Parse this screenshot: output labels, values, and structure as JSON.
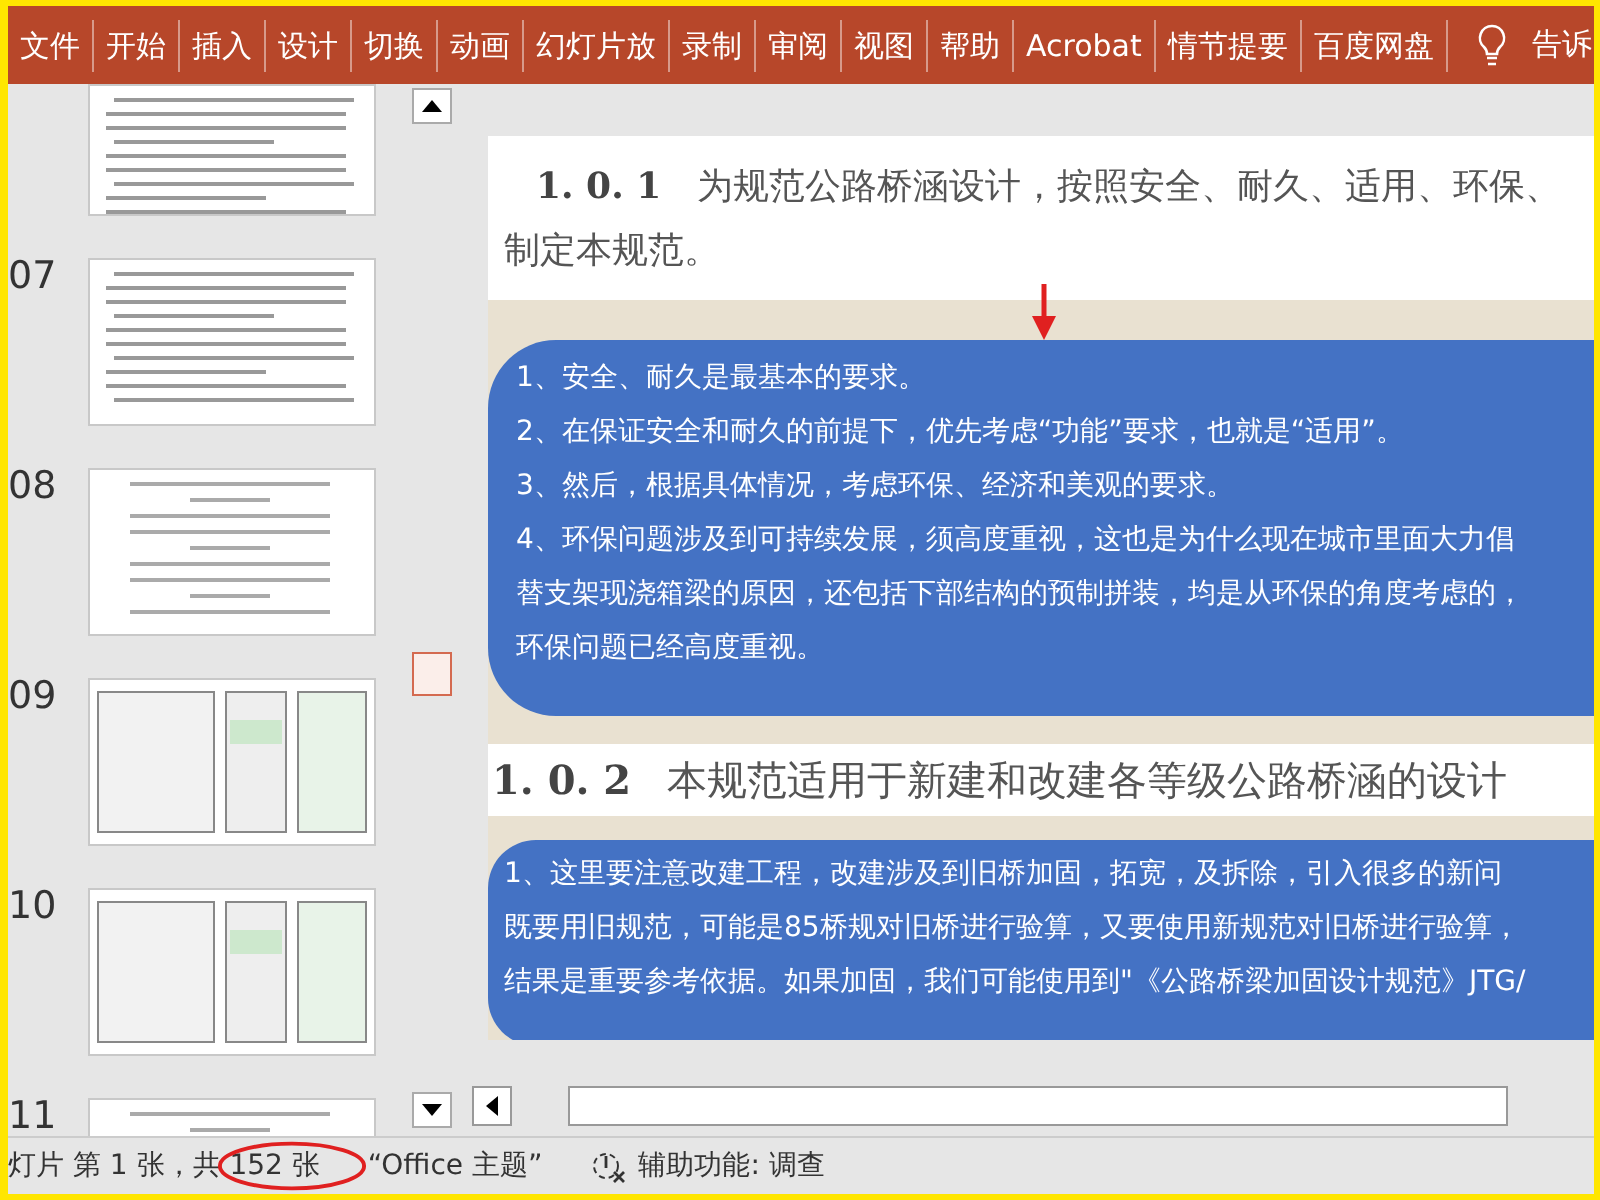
{
  "ribbon": {
    "tabs": [
      {
        "label": "文件"
      },
      {
        "label": "开始"
      },
      {
        "label": "插入"
      },
      {
        "label": "设计"
      },
      {
        "label": "切换"
      },
      {
        "label": "动画"
      },
      {
        "label": "幻灯片放"
      },
      {
        "label": "录制"
      },
      {
        "label": "审阅"
      },
      {
        "label": "视图"
      },
      {
        "label": "帮助"
      },
      {
        "label": "Acrobat"
      },
      {
        "label": "情节提要"
      },
      {
        "label": "百度网盘"
      }
    ],
    "tell_me": "告诉"
  },
  "thumbnails": [
    {
      "kind": "document"
    },
    {
      "number": "07",
      "kind": "document"
    },
    {
      "number": "08",
      "kind": "formula"
    },
    {
      "number": "09",
      "kind": "dialogs"
    },
    {
      "number": "10",
      "kind": "dialogs"
    },
    {
      "number": "11",
      "kind": "formula"
    }
  ],
  "slide": {
    "sections": [
      {
        "number": "1. 0. 1",
        "lines": [
          "为规范公路桥涵设计，按照安全、耐久、适用、环保、",
          "制定本规范。"
        ],
        "points": [
          {
            "lines": [
              "1、安全、耐久是最基本的要求。"
            ]
          },
          {
            "lines": [
              "2、在保证安全和耐久的前提下，优先考虑“功能”要求，也就是“适用”。"
            ]
          },
          {
            "lines": [
              "3、然后，根据具体情况，考虑环保、经济和美观的要求。"
            ]
          },
          {
            "lines": [
              "4、环保问题涉及到可持续发展，须高度重视，这也是为什么现在城市里面大力倡",
              "替支架现浇箱梁的原因，还包括下部结构的预制拼装，均是从环保的角度考虑的，",
              "环保问题已经高度重视。"
            ]
          }
        ]
      },
      {
        "number": "1. 0. 2",
        "lines": [
          "本规范适用于新建和改建各等级公路桥涵的设计"
        ],
        "points": [
          {
            "lines": [
              "1、这里要注意改建工程，改建涉及到旧桥加固，拓宽，及拆除，引入很多的新问",
              "既要用旧规范，可能是85桥规对旧桥进行验算，又要使用新规范对旧桥进行验算，",
              "结果是重要参考依据。如果加固，我们可能使用到\"《公路桥梁加固设计规范》JTG/"
            ]
          }
        ]
      }
    ]
  },
  "status_bar": {
    "slide_info": "灯片 第 1 张，共 152 张",
    "theme": "“Office 主题”",
    "accessibility": "辅助功能: 调查"
  }
}
